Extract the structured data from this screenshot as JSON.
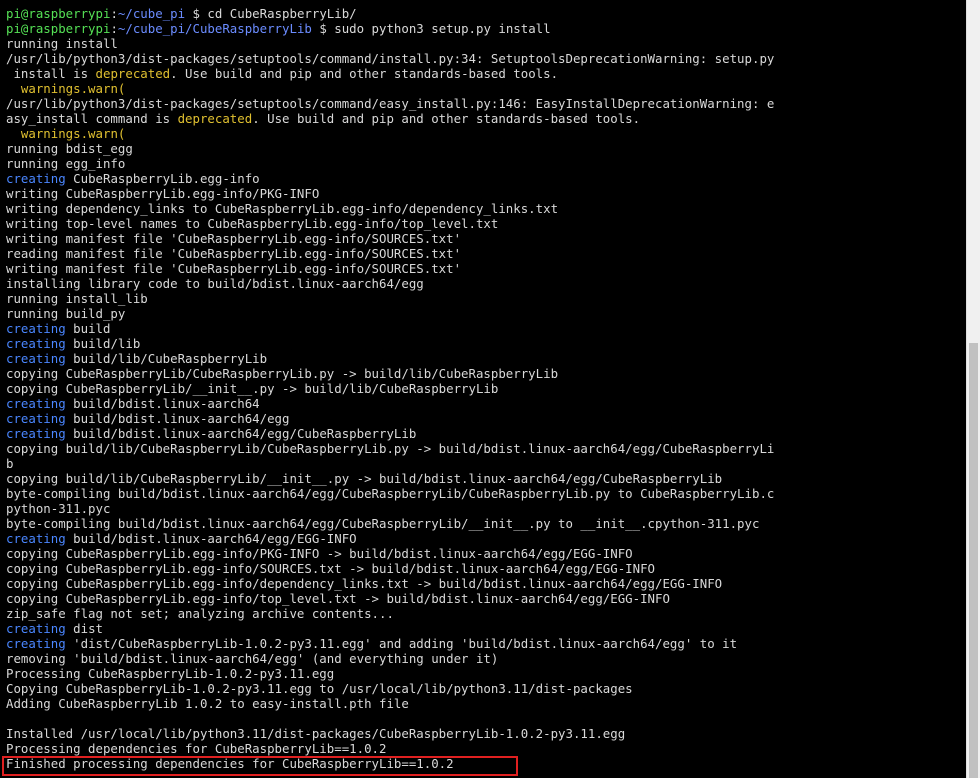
{
  "colors": {
    "default": "#d9d9d9",
    "prompt_user": "#55e055",
    "prompt_path": "#6b8cff",
    "creating": "#4a86ff",
    "warning": "#e0c030",
    "highlight_border": "#e02020"
  },
  "terminal": {
    "lines": [
      [
        {
          "t": "pi@raspberrypi",
          "c": "prompt_user"
        },
        {
          "t": ":",
          "c": "default"
        },
        {
          "t": "~/cube_pi",
          "c": "prompt_path"
        },
        {
          "t": " $ cd CubeRaspberryLib/",
          "c": "default"
        }
      ],
      [
        {
          "t": "pi@raspberrypi",
          "c": "prompt_user"
        },
        {
          "t": ":",
          "c": "default"
        },
        {
          "t": "~/cube_pi/CubeRaspberryLib",
          "c": "prompt_path"
        },
        {
          "t": " $ sudo python3 setup.py install",
          "c": "default"
        }
      ],
      [
        {
          "t": "running install",
          "c": "default"
        }
      ],
      [
        {
          "t": "/usr/lib/python3/dist-packages/setuptools/command/install.py:34: SetuptoolsDeprecationWarning: setup.py",
          "c": "default"
        }
      ],
      [
        {
          "t": " install is ",
          "c": "default"
        },
        {
          "t": "deprecated",
          "c": "warning"
        },
        {
          "t": ". Use build and pip and other standards-based tools.",
          "c": "default"
        }
      ],
      [
        {
          "t": "  ",
          "c": "default"
        },
        {
          "t": "warnings.warn(",
          "c": "warning"
        }
      ],
      [
        {
          "t": "/usr/lib/python3/dist-packages/setuptools/command/easy_install.py:146: EasyInstallDeprecationWarning: e",
          "c": "default"
        }
      ],
      [
        {
          "t": "asy_install command is ",
          "c": "default"
        },
        {
          "t": "deprecated",
          "c": "warning"
        },
        {
          "t": ". Use build and pip and other standards-based tools.",
          "c": "default"
        }
      ],
      [
        {
          "t": "  ",
          "c": "default"
        },
        {
          "t": "warnings.warn(",
          "c": "warning"
        }
      ],
      [
        {
          "t": "running bdist_egg",
          "c": "default"
        }
      ],
      [
        {
          "t": "running egg_info",
          "c": "default"
        }
      ],
      [
        {
          "t": "creating",
          "c": "creating"
        },
        {
          "t": " CubeRaspberryLib.egg-info",
          "c": "default"
        }
      ],
      [
        {
          "t": "writing CubeRaspberryLib.egg-info/PKG-INFO",
          "c": "default"
        }
      ],
      [
        {
          "t": "writing dependency_links to CubeRaspberryLib.egg-info/dependency_links.txt",
          "c": "default"
        }
      ],
      [
        {
          "t": "writing top-level names to CubeRaspberryLib.egg-info/top_level.txt",
          "c": "default"
        }
      ],
      [
        {
          "t": "writing manifest file 'CubeRaspberryLib.egg-info/SOURCES.txt'",
          "c": "default"
        }
      ],
      [
        {
          "t": "reading manifest file 'CubeRaspberryLib.egg-info/SOURCES.txt'",
          "c": "default"
        }
      ],
      [
        {
          "t": "writing manifest file 'CubeRaspberryLib.egg-info/SOURCES.txt'",
          "c": "default"
        }
      ],
      [
        {
          "t": "installing library code to build/bdist.linux-aarch64/egg",
          "c": "default"
        }
      ],
      [
        {
          "t": "running install_lib",
          "c": "default"
        }
      ],
      [
        {
          "t": "running build_py",
          "c": "default"
        }
      ],
      [
        {
          "t": "creating",
          "c": "creating"
        },
        {
          "t": " build",
          "c": "default"
        }
      ],
      [
        {
          "t": "creating",
          "c": "creating"
        },
        {
          "t": " build/lib",
          "c": "default"
        }
      ],
      [
        {
          "t": "creating",
          "c": "creating"
        },
        {
          "t": " build/lib/CubeRaspberryLib",
          "c": "default"
        }
      ],
      [
        {
          "t": "copying CubeRaspberryLib/CubeRaspberryLib.py -> build/lib/CubeRaspberryLib",
          "c": "default"
        }
      ],
      [
        {
          "t": "copying CubeRaspberryLib/__init__.py -> build/lib/CubeRaspberryLib",
          "c": "default"
        }
      ],
      [
        {
          "t": "creating",
          "c": "creating"
        },
        {
          "t": " build/bdist.linux-aarch64",
          "c": "default"
        }
      ],
      [
        {
          "t": "creating",
          "c": "creating"
        },
        {
          "t": " build/bdist.linux-aarch64/egg",
          "c": "default"
        }
      ],
      [
        {
          "t": "creating",
          "c": "creating"
        },
        {
          "t": " build/bdist.linux-aarch64/egg/CubeRaspberryLib",
          "c": "default"
        }
      ],
      [
        {
          "t": "copying build/lib/CubeRaspberryLib/CubeRaspberryLib.py -> build/bdist.linux-aarch64/egg/CubeRaspberryLi",
          "c": "default"
        }
      ],
      [
        {
          "t": "b",
          "c": "default"
        }
      ],
      [
        {
          "t": "copying build/lib/CubeRaspberryLib/__init__.py -> build/bdist.linux-aarch64/egg/CubeRaspberryLib",
          "c": "default"
        }
      ],
      [
        {
          "t": "byte-compiling build/bdist.linux-aarch64/egg/CubeRaspberryLib/CubeRaspberryLib.py to CubeRaspberryLib.c",
          "c": "default"
        }
      ],
      [
        {
          "t": "python-311.pyc",
          "c": "default"
        }
      ],
      [
        {
          "t": "byte-compiling build/bdist.linux-aarch64/egg/CubeRaspberryLib/__init__.py to __init__.cpython-311.pyc",
          "c": "default"
        }
      ],
      [
        {
          "t": "creating",
          "c": "creating"
        },
        {
          "t": " build/bdist.linux-aarch64/egg/EGG-INFO",
          "c": "default"
        }
      ],
      [
        {
          "t": "copying CubeRaspberryLib.egg-info/PKG-INFO -> build/bdist.linux-aarch64/egg/EGG-INFO",
          "c": "default"
        }
      ],
      [
        {
          "t": "copying CubeRaspberryLib.egg-info/SOURCES.txt -> build/bdist.linux-aarch64/egg/EGG-INFO",
          "c": "default"
        }
      ],
      [
        {
          "t": "copying CubeRaspberryLib.egg-info/dependency_links.txt -> build/bdist.linux-aarch64/egg/EGG-INFO",
          "c": "default"
        }
      ],
      [
        {
          "t": "copying CubeRaspberryLib.egg-info/top_level.txt -> build/bdist.linux-aarch64/egg/EGG-INFO",
          "c": "default"
        }
      ],
      [
        {
          "t": "zip_safe flag not set; analyzing archive contents...",
          "c": "default"
        }
      ],
      [
        {
          "t": "creating",
          "c": "creating"
        },
        {
          "t": " dist",
          "c": "default"
        }
      ],
      [
        {
          "t": "creating",
          "c": "creating"
        },
        {
          "t": " 'dist/CubeRaspberryLib-1.0.2-py3.11.egg' and adding 'build/bdist.linux-aarch64/egg' to it",
          "c": "default"
        }
      ],
      [
        {
          "t": "removing 'build/bdist.linux-aarch64/egg' (and everything under it)",
          "c": "default"
        }
      ],
      [
        {
          "t": "Processing CubeRaspberryLib-1.0.2-py3.11.egg",
          "c": "default"
        }
      ],
      [
        {
          "t": "Copying CubeRaspberryLib-1.0.2-py3.11.egg to /usr/local/lib/python3.11/dist-packages",
          "c": "default"
        }
      ],
      [
        {
          "t": "Adding CubeRaspberryLib 1.0.2 to easy-install.pth file",
          "c": "default"
        }
      ],
      [
        {
          "t": "",
          "c": "default"
        }
      ],
      [
        {
          "t": "Installed /usr/local/lib/python3.11/dist-packages/CubeRaspberryLib-1.0.2-py3.11.egg",
          "c": "default"
        }
      ],
      [
        {
          "t": "Processing dependencies for CubeRaspberryLib==1.0.2",
          "c": "default"
        }
      ],
      [
        {
          "t": "Finished processing dependencies for CubeRaspberryLib==1.0.2",
          "c": "default"
        }
      ]
    ]
  }
}
